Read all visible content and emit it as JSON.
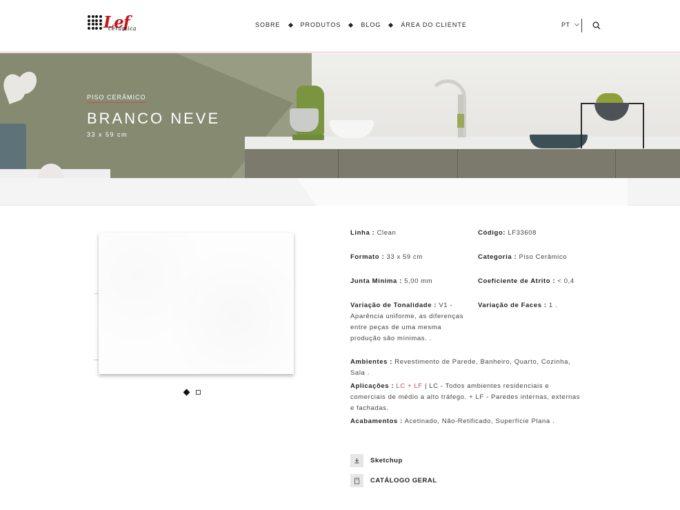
{
  "header": {
    "logo_text": "Lef",
    "logo_sub": "cerâmica",
    "nav": [
      "SOBRE",
      "PRODUTOS",
      "BLOG",
      "ÁREA DO CLIENTE"
    ],
    "lang": "PT",
    "search_icon": "search-icon"
  },
  "hero": {
    "category": "PISO CERÂMICO",
    "title": "BRANCO NEVE",
    "size": "33 x 59 cm"
  },
  "gallery": {
    "active_index": 0,
    "count": 2
  },
  "specs": {
    "linha_label": "Linha :",
    "linha_value": "Clean",
    "codigo_label": "Código:",
    "codigo_value": "LF33608",
    "formato_label": "Formato :",
    "formato_value": "33 x 59 cm",
    "categoria_label": "Categoria :",
    "categoria_value": "Piso Cerâmico",
    "junta_label": "Junta Mínima :",
    "junta_value": "5,00 mm",
    "atrito_label": "Coeficiente de Atrito :",
    "atrito_value": "< 0,4",
    "tonalidade_label": "Variação de Tonalidade :",
    "tonalidade_value": "V1 - Aparência uniforme, as diferenças entre peças de uma mesma produção são mínimas. .",
    "faces_label": "Variação de Faces :",
    "faces_value": "1 .",
    "ambientes_label": "Ambientes :",
    "ambientes_value": "Revestimento de Parede, Banheiro, Quarto, Cozinha, Sala .",
    "aplicacoes_label": "Aplicações :",
    "aplicacoes_highlight": "LC + LF",
    "aplicacoes_value": "| LC - Todos ambientes residenciais e comerciais de médio a alto tráfego. + LF - Paredes internas, externas e fachadas.",
    "acabamentos_label": "Acabamentos :",
    "acabamentos_value": "Acetinado, Não-Retificado, Superfície Plana ."
  },
  "downloads": {
    "sketchup": "Sketchup",
    "catalogo": "CATÁLOGO GERAL"
  },
  "colors": {
    "brand_red": "#c4161c",
    "accent": "#c74a57"
  }
}
